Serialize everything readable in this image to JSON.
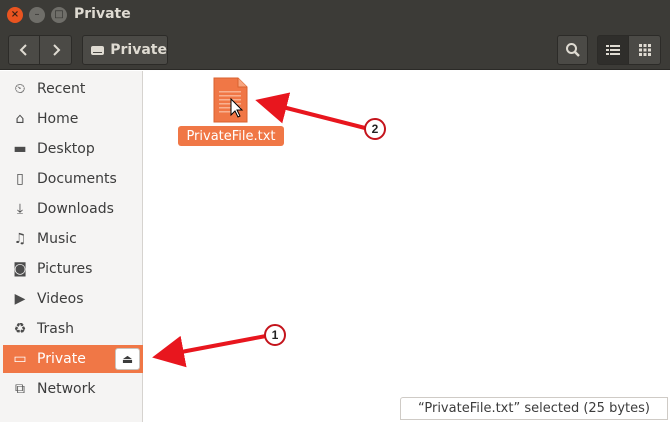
{
  "window": {
    "title": "Private",
    "close_glyph": "×",
    "min_glyph": "–",
    "max_glyph": "□"
  },
  "toolbar": {
    "back_glyph": "‹",
    "forward_glyph": "›",
    "path_label": "Private",
    "search_icon": "search-icon",
    "list_view_icon": "list-view-icon",
    "grid_view_icon": "grid-view-icon"
  },
  "sidebar": {
    "items": [
      {
        "label": "Recent",
        "icon": "clock-icon",
        "glyph": "⏲"
      },
      {
        "label": "Home",
        "icon": "home-icon",
        "glyph": "⌂"
      },
      {
        "label": "Desktop",
        "icon": "folder-icon",
        "glyph": "▬"
      },
      {
        "label": "Documents",
        "icon": "document-icon",
        "glyph": "▯"
      },
      {
        "label": "Downloads",
        "icon": "download-icon",
        "glyph": "⤓"
      },
      {
        "label": "Music",
        "icon": "music-icon",
        "glyph": "♫"
      },
      {
        "label": "Pictures",
        "icon": "camera-icon",
        "glyph": "◙"
      },
      {
        "label": "Videos",
        "icon": "video-icon",
        "glyph": "▶"
      },
      {
        "label": "Trash",
        "icon": "trash-icon",
        "glyph": "♻"
      },
      {
        "label": "Private",
        "icon": "drive-icon",
        "glyph": "▭",
        "active": true,
        "eject_glyph": "⏏"
      },
      {
        "label": "Network",
        "icon": "network-icon",
        "glyph": "⧉"
      }
    ]
  },
  "files": [
    {
      "name": "PrivateFile.txt",
      "icon": "text-file-icon"
    }
  ],
  "status": {
    "text": "“PrivateFile.txt” selected  (25 bytes)"
  },
  "annotations": [
    {
      "number": "1"
    },
    {
      "number": "2"
    }
  ],
  "colors": {
    "accent": "#f07746",
    "chrome": "#3c3b37",
    "annotation_red": "#e8161e"
  }
}
